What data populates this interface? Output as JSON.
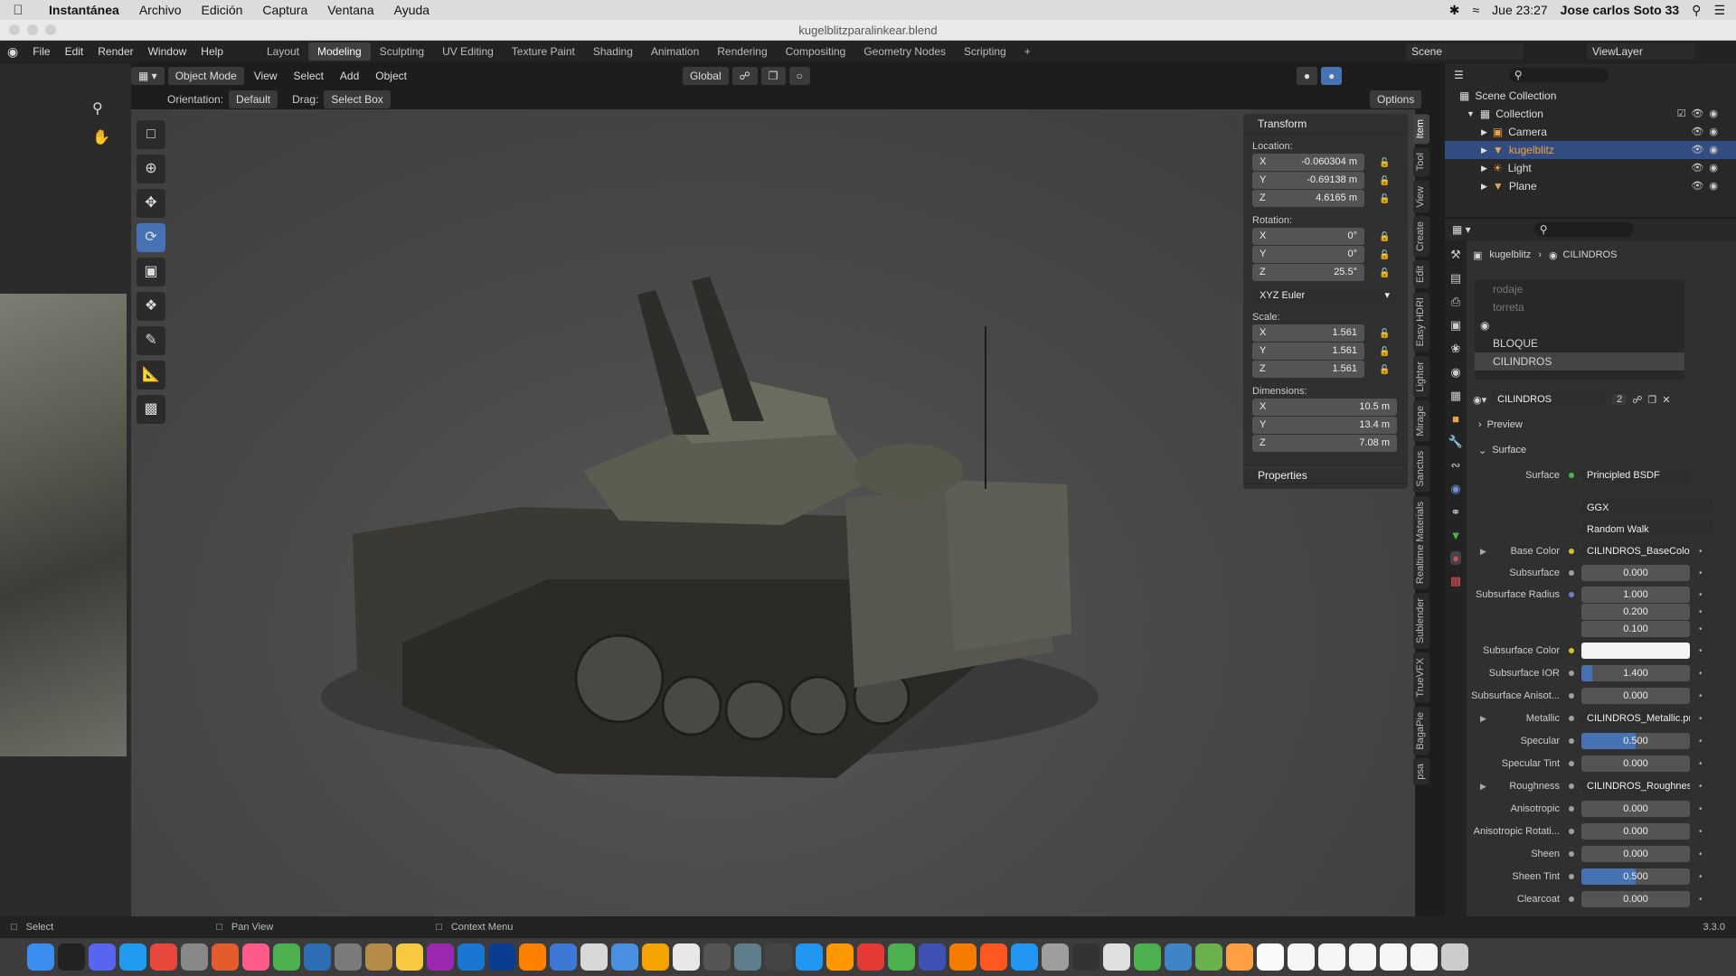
{
  "mac_menubar": {
    "app_name": "Instantánea",
    "menus": [
      "Archivo",
      "Edición",
      "Captura",
      "Ventana",
      "Ayuda"
    ],
    "datetime": "Jue 23:27",
    "user": "Jose carlos Soto 33"
  },
  "window_title": "kugelblitzparalinkear.blend",
  "blender_menu": [
    "File",
    "Edit",
    "Render",
    "Window",
    "Help"
  ],
  "workspaces": [
    "Layout",
    "Modeling",
    "Sculpting",
    "UV Editing",
    "Texture Paint",
    "Shading",
    "Animation",
    "Rendering",
    "Compositing",
    "Geometry Nodes",
    "Scripting"
  ],
  "active_workspace": "Modeling",
  "scene_name": "Scene",
  "view_layer_name": "ViewLayer",
  "viewport_header": {
    "mode": "Object Mode",
    "menus": [
      "View",
      "Select",
      "Add",
      "Object"
    ],
    "transform_orientation": "Global",
    "orientation_label": "Orientation:",
    "orientation_value": "Default",
    "drag_label": "Drag:",
    "drag_value": "Select Box",
    "options_label": "Options"
  },
  "n_panel": {
    "transform_title": "Transform",
    "location_label": "Location:",
    "location": [
      {
        "axis": "X",
        "value": "-0.060304 m"
      },
      {
        "axis": "Y",
        "value": "-0.69138 m"
      },
      {
        "axis": "Z",
        "value": "4.6165 m"
      }
    ],
    "rotation_label": "Rotation:",
    "rotation": [
      {
        "axis": "X",
        "value": "0°"
      },
      {
        "axis": "Y",
        "value": "0°"
      },
      {
        "axis": "Z",
        "value": "25.5°"
      }
    ],
    "rotation_mode": "XYZ Euler",
    "scale_label": "Scale:",
    "scale": [
      {
        "axis": "X",
        "value": "1.561"
      },
      {
        "axis": "Y",
        "value": "1.561"
      },
      {
        "axis": "Z",
        "value": "1.561"
      }
    ],
    "dimensions_label": "Dimensions:",
    "dimensions": [
      {
        "axis": "X",
        "value": "10.5 m"
      },
      {
        "axis": "Y",
        "value": "13.4 m"
      },
      {
        "axis": "Z",
        "value": "7.08 m"
      }
    ],
    "properties_title": "Properties"
  },
  "side_tabs": [
    "Item",
    "Tool",
    "View",
    "Create",
    "Edit",
    "Easy HDRI",
    "Lighter",
    "Mirage",
    "Sanctus",
    "Realtime Materials",
    "Sublender",
    "TrueVFX",
    "BagaPie",
    "psa"
  ],
  "outliner": {
    "root": "Scene Collection",
    "collection": "Collection",
    "items": [
      {
        "name": "Camera",
        "selected": false
      },
      {
        "name": "kugelblitz",
        "selected": true
      },
      {
        "name": "Light",
        "selected": false
      },
      {
        "name": "Plane",
        "selected": false
      }
    ]
  },
  "properties": {
    "breadcrumb_object": "kugelblitz",
    "breadcrumb_material": "CILINDROS",
    "material_slots": [
      "rodaje",
      "torreta",
      "",
      "BLOQUE",
      "CILINDROS"
    ],
    "active_material": "CILINDROS",
    "material_users": "2",
    "preview_label": "Preview",
    "surface_section": "Surface",
    "surface_label": "Surface",
    "surface_value": "Principled BSDF",
    "distribution": "GGX",
    "subsurface_method": "Random Walk",
    "rows": [
      {
        "label": "Base Color",
        "value": "CILINDROS_BaseColor...",
        "kind": "text",
        "dot": "yellow",
        "expand": true
      },
      {
        "label": "Subsurface",
        "value": "0.000",
        "kind": "num",
        "dot": "grey",
        "fill": 0
      },
      {
        "label": "Subsurface Radius",
        "value": "1.000",
        "kind": "num",
        "dot": "blue",
        "fill": 0
      },
      {
        "label": "",
        "value": "0.200",
        "kind": "num",
        "dot": "none",
        "fill": 0
      },
      {
        "label": "",
        "value": "0.100",
        "kind": "num",
        "dot": "none",
        "fill": 0
      },
      {
        "label": "Subsurface Color",
        "value": "",
        "kind": "color",
        "dot": "yellow"
      },
      {
        "label": "Subsurface IOR",
        "value": "1.400",
        "kind": "num",
        "dot": "grey",
        "fill": 0.1
      },
      {
        "label": "Subsurface Anisot...",
        "value": "0.000",
        "kind": "num",
        "dot": "grey",
        "fill": 0
      },
      {
        "label": "Metallic",
        "value": "CILINDROS_Metallic.png",
        "kind": "text",
        "dot": "grey",
        "expand": true
      },
      {
        "label": "Specular",
        "value": "0.500",
        "kind": "num",
        "dot": "grey",
        "fill": 0.5
      },
      {
        "label": "Specular Tint",
        "value": "0.000",
        "kind": "num",
        "dot": "grey",
        "fill": 0
      },
      {
        "label": "Roughness",
        "value": "CILINDROS_Roughness...",
        "kind": "text",
        "dot": "grey",
        "expand": true
      },
      {
        "label": "Anisotropic",
        "value": "0.000",
        "kind": "num",
        "dot": "grey",
        "fill": 0
      },
      {
        "label": "Anisotropic Rotati...",
        "value": "0.000",
        "kind": "num",
        "dot": "grey",
        "fill": 0
      },
      {
        "label": "Sheen",
        "value": "0.000",
        "kind": "num",
        "dot": "grey",
        "fill": 0
      },
      {
        "label": "Sheen Tint",
        "value": "0.500",
        "kind": "num",
        "dot": "grey",
        "fill": 0.5
      },
      {
        "label": "Clearcoat",
        "value": "0.000",
        "kind": "num",
        "dot": "grey",
        "fill": 0
      }
    ]
  },
  "statusbar": {
    "select": "Select",
    "pan": "Pan View",
    "context": "Context Menu",
    "version": "3.3.0"
  }
}
